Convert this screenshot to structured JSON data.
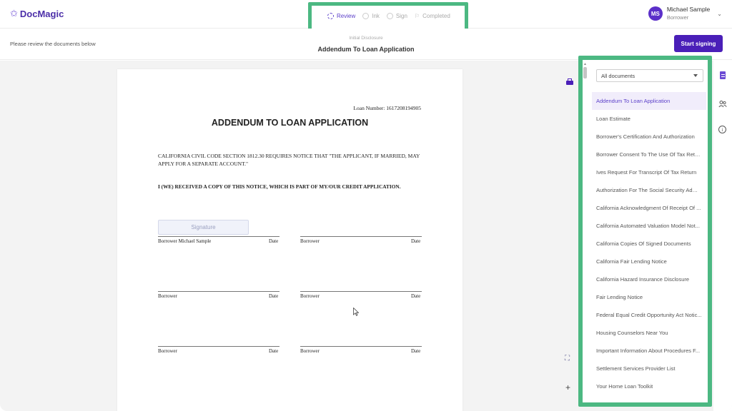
{
  "app": {
    "logo_text": "DocMagic",
    "accent": "#4a1fb8",
    "highlight": "#4cb882"
  },
  "steps": [
    {
      "label": "Review",
      "state": "active"
    },
    {
      "label": "Ink",
      "state": "pending"
    },
    {
      "label": "Sign",
      "state": "pending"
    },
    {
      "label": "Completed",
      "state": "pending"
    }
  ],
  "user": {
    "initials": "MS",
    "name": "Michael Sample",
    "role": "Borrower"
  },
  "subheader": {
    "note": "Please review the documents below",
    "category": "Initial Disclosure",
    "title": "Addendum To Loan Application",
    "start_button": "Start signing"
  },
  "document": {
    "loan_number": "Loan Number: 1617208194905",
    "title": "ADDENDUM TO LOAN APPLICATION",
    "para1": "CALIFORNIA CIVIL CODE SECTION 1812.30 REQUIRES NOTICE THAT \"THE APPLICANT, IF MARRIED, MAY APPLY FOR A SEPARATE ACCOUNT.\"",
    "para2": "I (WE) RECEIVED A COPY OF THIS NOTICE, WHICH IS PART OF MY/OUR CREDIT APPLICATION.",
    "signature_button": "Signature",
    "borrower_named": "Borrower Michael Sample",
    "borrower": "Borrower",
    "date": "Date"
  },
  "panel": {
    "filter_value": "All documents",
    "documents": [
      "Addendum To Loan Application",
      "Loan Estimate",
      "Borrower's Certification And Authorization",
      "Borrower Consent To The Use Of Tax Retur...",
      "Ives Request For Transcript Of Tax Return",
      "Authorization For The Social Security Admi...",
      "California Acknowledgment Of Receipt Of ...",
      "California Automated Valuation Model Not...",
      "California Copies Of Signed Documents",
      "California Fair Lending Notice",
      "California Hazard Insurance Disclosure",
      "Fair Lending Notice",
      "Federal Equal Credit Opportunity Act Notic...",
      "Housing Counselors Near You",
      "Important Information About Procedures F...",
      "Settlement Services Provider List",
      "Your Home Loan Toolkit"
    ],
    "selected_index": 0
  },
  "icons": {
    "print": "printer-icon",
    "fit": "fit-screen-icon",
    "zoom": "zoom-in-icon",
    "documents": "document-icon",
    "participants": "people-icon",
    "info": "info-icon"
  }
}
